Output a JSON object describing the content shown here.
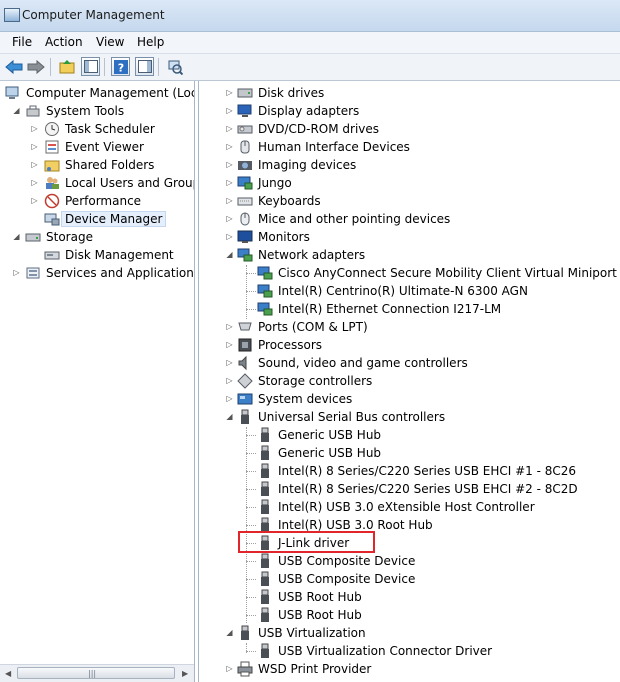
{
  "window": {
    "title": "Computer Management"
  },
  "menu": {
    "file": "File",
    "action": "Action",
    "view": "View",
    "help": "Help"
  },
  "left_tree": {
    "root": "Computer Management (Local",
    "system_tools": "System Tools",
    "task_scheduler": "Task Scheduler",
    "event_viewer": "Event Viewer",
    "shared_folders": "Shared Folders",
    "local_users": "Local Users and Groups",
    "performance": "Performance",
    "device_manager": "Device Manager",
    "storage": "Storage",
    "disk_management": "Disk Management",
    "services": "Services and Applications"
  },
  "devices": {
    "disk_drives": "Disk drives",
    "display_adapters": "Display adapters",
    "dvd": "DVD/CD-ROM drives",
    "hid": "Human Interface Devices",
    "imaging": "Imaging devices",
    "jungo": "Jungo",
    "keyboards": "Keyboards",
    "mice": "Mice and other pointing devices",
    "monitors": "Monitors",
    "network": "Network adapters",
    "net1": "Cisco AnyConnect Secure Mobility Client Virtual Miniport Adapte",
    "net2": "Intel(R) Centrino(R) Ultimate-N 6300 AGN",
    "net3": "Intel(R) Ethernet Connection I217-LM",
    "ports": "Ports (COM & LPT)",
    "processors": "Processors",
    "sound": "Sound, video and game controllers",
    "storage_ctrl": "Storage controllers",
    "system_devices": "System devices",
    "usb": "Universal Serial Bus controllers",
    "usb1": "Generic USB Hub",
    "usb2": "Generic USB Hub",
    "usb3": "Intel(R) 8 Series/C220 Series USB EHCI #1 - 8C26",
    "usb4": "Intel(R) 8 Series/C220 Series USB EHCI #2 - 8C2D",
    "usb5": "Intel(R) USB 3.0 eXtensible Host Controller",
    "usb6": "Intel(R) USB 3.0 Root Hub",
    "usb7": "J-Link driver",
    "usb8": "USB Composite Device",
    "usb9": "USB Composite Device",
    "usb10": "USB Root Hub",
    "usb11": "USB Root Hub",
    "usb_virt": "USB Virtualization",
    "usb_virt1": "USB Virtualization Connector Driver",
    "wsd": "WSD Print Provider"
  },
  "colors": {
    "highlight": "#e0262a",
    "selection": "#e5eefb"
  }
}
